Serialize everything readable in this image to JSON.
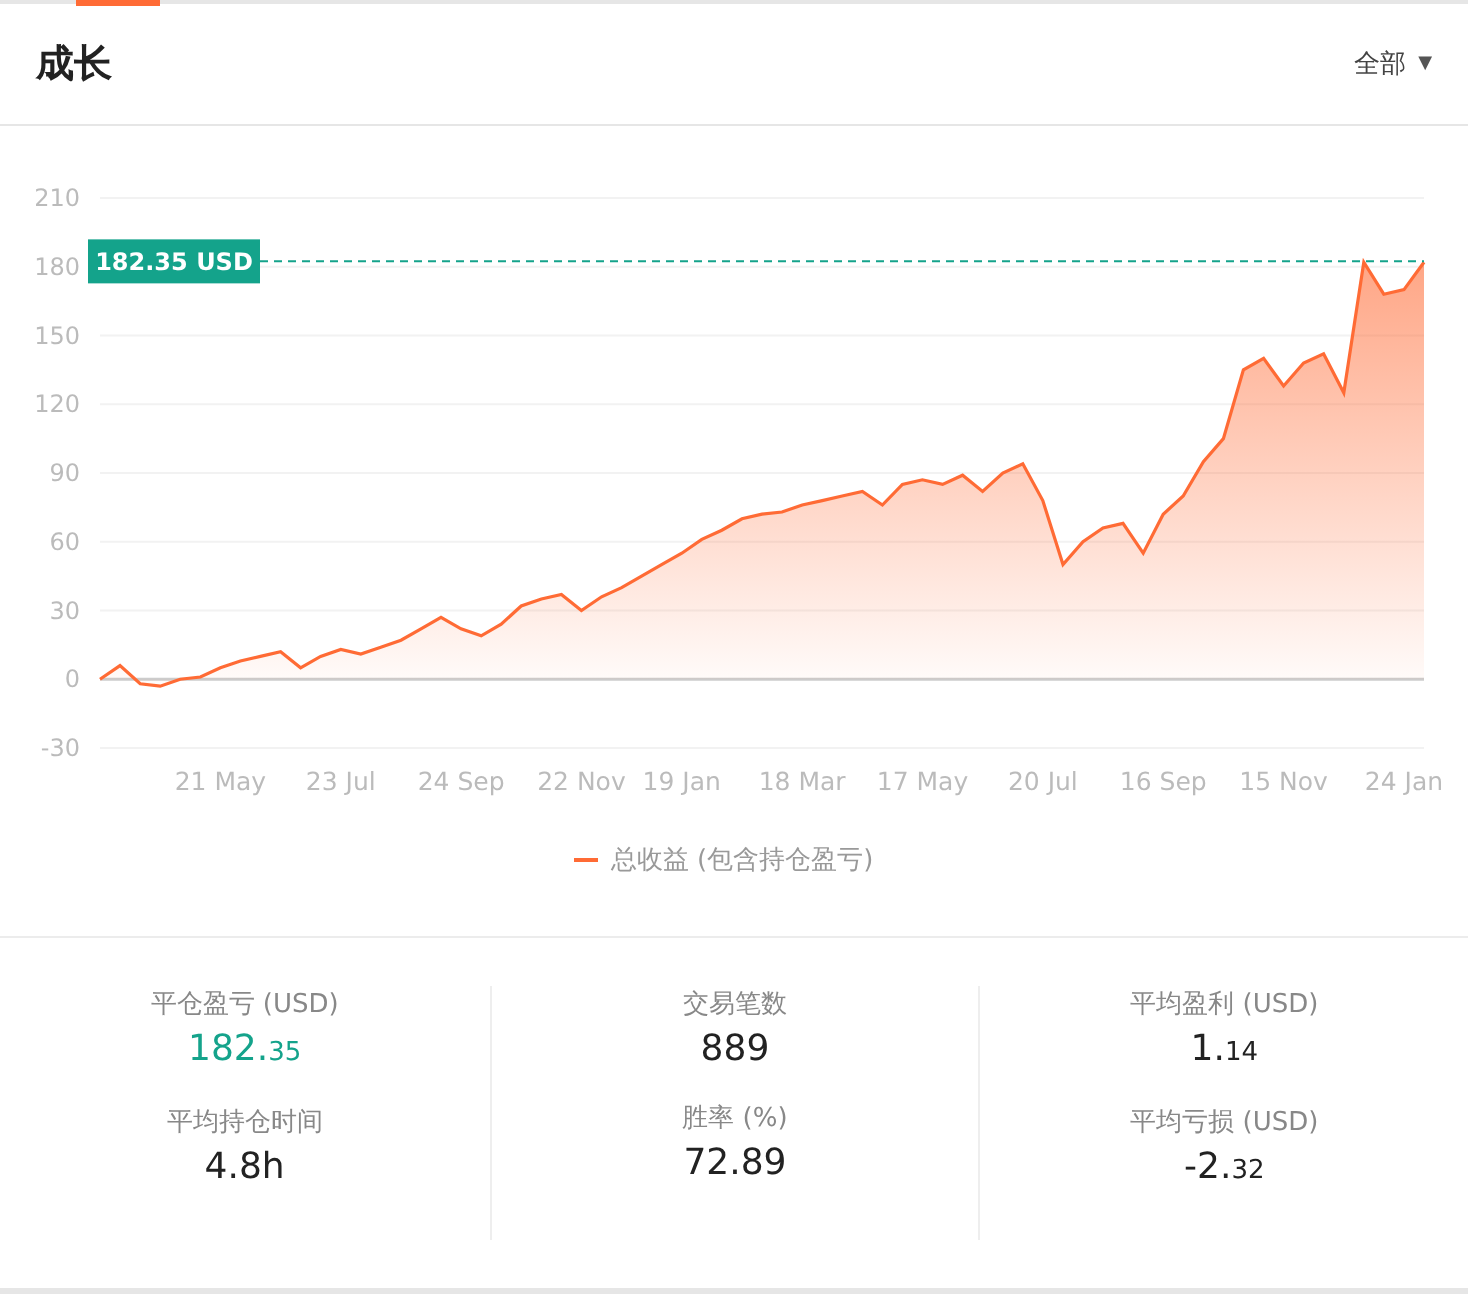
{
  "header": {
    "title": "成长",
    "filter": {
      "label": "全部",
      "caret": "▼"
    }
  },
  "chart": {
    "chart_data": {
      "type": "area",
      "grid": true,
      "ref_lines": [
        {
          "axis": "y",
          "value": 182.35,
          "label": "182.35 USD",
          "color": "#14a38b"
        }
      ],
      "categories": [
        null,
        null,
        null,
        null,
        null,
        null,
        "21 May",
        null,
        null,
        null,
        null,
        null,
        "23 Jul",
        null,
        null,
        null,
        null,
        null,
        "24 Sep",
        null,
        null,
        null,
        null,
        null,
        "22 Nov",
        null,
        null,
        null,
        null,
        "19 Jan",
        null,
        null,
        null,
        null,
        null,
        "18 Mar",
        null,
        null,
        null,
        null,
        null,
        "17 May",
        null,
        null,
        null,
        null,
        null,
        "20 Jul",
        null,
        null,
        null,
        null,
        null,
        "16 Sep",
        null,
        null,
        null,
        null,
        null,
        "15 Nov",
        null,
        null,
        null,
        null,
        null,
        "24 Jan",
        null
      ],
      "series": [
        {
          "name": "总收益 (包含持仓盈亏)",
          "color": "#ff6b35",
          "values": [
            0,
            6,
            -2,
            -3,
            0,
            1,
            5,
            8,
            10,
            12,
            5,
            10,
            13,
            11,
            14,
            17,
            22,
            27,
            22,
            19,
            24,
            32,
            35,
            37,
            30,
            36,
            40,
            45,
            50,
            55,
            61,
            65,
            70,
            72,
            73,
            76,
            78,
            80,
            82,
            76,
            85,
            87,
            85,
            89,
            82,
            90,
            94,
            78,
            50,
            60,
            66,
            68,
            55,
            72,
            80,
            95,
            105,
            135,
            140,
            128,
            138,
            142,
            125,
            182,
            168,
            170,
            182
          ]
        }
      ],
      "ylim": [
        -30,
        210
      ],
      "yticks": [
        -30,
        0,
        30,
        60,
        90,
        120,
        150,
        180,
        210
      ]
    }
  },
  "stats": [
    {
      "label": "平仓盈亏 (USD)",
      "whole": "182.",
      "fraction": "35",
      "color": "#14a38b"
    },
    {
      "label": "交易笔数",
      "whole": "889",
      "color": "#222222"
    },
    {
      "label": "平均盈利 (USD)",
      "whole": "1.",
      "fraction": "14",
      "color": "#222222"
    },
    {
      "label": "平均持仓时间",
      "whole": "4.8h",
      "color": "#222222"
    },
    {
      "label": "胜率 (%)",
      "whole": "72.89",
      "color": "#222222"
    },
    {
      "label": "平均亏损 (USD)",
      "whole": "-2.",
      "fraction": "32",
      "color": "#222222"
    }
  ]
}
